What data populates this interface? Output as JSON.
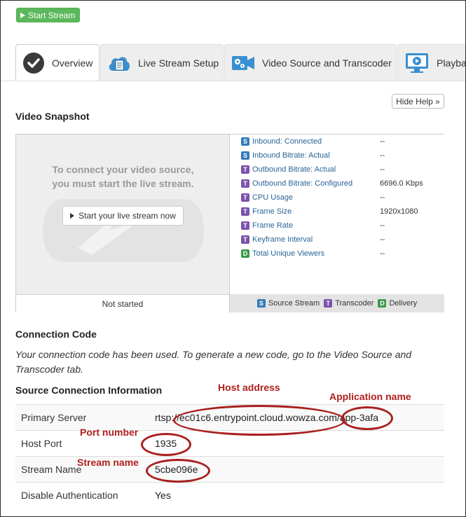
{
  "toolbar": {
    "start_label": "Start Stream"
  },
  "tabs": [
    {
      "label": "Overview",
      "icon": "check-circle-icon"
    },
    {
      "label": "Live Stream Setup",
      "icon": "cloud-document-icon"
    },
    {
      "label": "Video Source and Transcoder",
      "icon": "camera-gears-icon"
    },
    {
      "label": "Playba",
      "icon": "monitor-play-icon"
    }
  ],
  "help_label": "Hide Help »",
  "snapshot": {
    "title": "Video Snapshot",
    "message_line1": "To connect your video source,",
    "message_line2": "you must start the live stream.",
    "start_button": "Start your live stream now",
    "status": "Not started",
    "stats": [
      {
        "badge": "S",
        "label": "Inbound: Connected",
        "value": "--"
      },
      {
        "badge": "S",
        "label": "Inbound Bitrate: Actual",
        "value": "--"
      },
      {
        "badge": "T",
        "label": "Outbound Bitrate: Actual",
        "value": "--"
      },
      {
        "badge": "T",
        "label": "Outbound Bitrate: Configured",
        "value": "6696.0 Kbps"
      },
      {
        "badge": "T",
        "label": "CPU Usage",
        "value": "--"
      },
      {
        "badge": "T",
        "label": "Frame Size",
        "value": "1920x1080"
      },
      {
        "badge": "T",
        "label": "Frame Rate",
        "value": "--"
      },
      {
        "badge": "T",
        "label": "Keyframe Interval",
        "value": "--"
      },
      {
        "badge": "D",
        "label": "Total Unique Viewers",
        "value": "--"
      }
    ],
    "legend": [
      {
        "badge": "S",
        "label": "Source Stream"
      },
      {
        "badge": "T",
        "label": "Transcoder"
      },
      {
        "badge": "D",
        "label": "Delivery"
      }
    ]
  },
  "connection_code": {
    "title": "Connection Code",
    "text": "Your connection code has been used. To generate a new code, go to the Video Source and Transcoder tab."
  },
  "source_info": {
    "title": "Source Connection Information",
    "rows": [
      {
        "key": "Primary Server",
        "value": "rtsp://ec01c6.entrypoint.cloud.wowza.com/app-3afa"
      },
      {
        "key": "Host Port",
        "value": "1935"
      },
      {
        "key": "Stream Name",
        "value": "5cbe096e"
      },
      {
        "key": "Disable Authentication",
        "value": "Yes"
      }
    ]
  },
  "annotations": {
    "host_address": "Host address",
    "application_name": "Application name",
    "port_number": "Port number",
    "stream_name": "Stream name"
  },
  "colors": {
    "start_button": "#5cb85c",
    "annotation": "#b0201e",
    "badge_source": "#337ab7",
    "badge_transcoder": "#7b52ab",
    "badge_delivery": "#3a9a4a"
  }
}
